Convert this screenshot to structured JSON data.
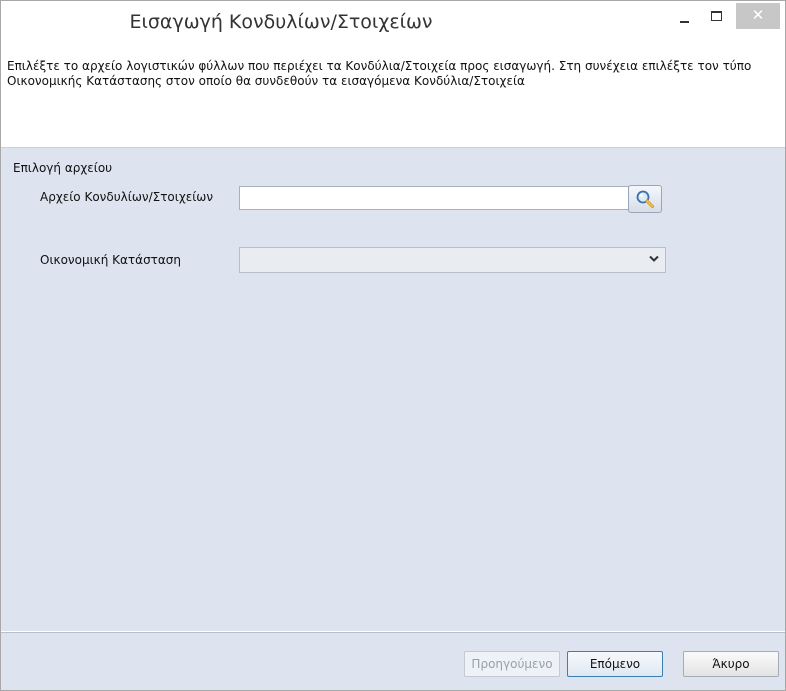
{
  "window": {
    "title": "Εισαγωγή Κονδυλίων/Στοιχείων",
    "close_symbol": "✕"
  },
  "description": {
    "text": "Επιλέξτε το αρχείο λογιστικών φύλλων που περιέχει τα Κονδύλια/Στοιχεία προς εισαγωγή. Στη συνέχεια επιλέξτε τον τύπο Οικονομικής Κατάστασης στον οποίο θα συνδεθούν τα εισαγόμενα Κονδύλια/Στοιχεία"
  },
  "form": {
    "group_title": "Επιλογή αρχείου",
    "file_label": "Αρχείο Κονδυλίων/Στοιχείων",
    "file_value": "",
    "browse_icon": "magnifier-icon",
    "status_label": "Οικονομική Κατάσταση",
    "status_value": "",
    "dropdown_icon": "chevron-down-icon"
  },
  "buttons": {
    "previous": "Προηγούμενο",
    "next": "Επόμενο",
    "cancel": "Άκυρο"
  },
  "colors": {
    "panel_bg": "#dde3ef",
    "close_bg": "#c7c7c7",
    "next_border": "#3c7fb1"
  }
}
